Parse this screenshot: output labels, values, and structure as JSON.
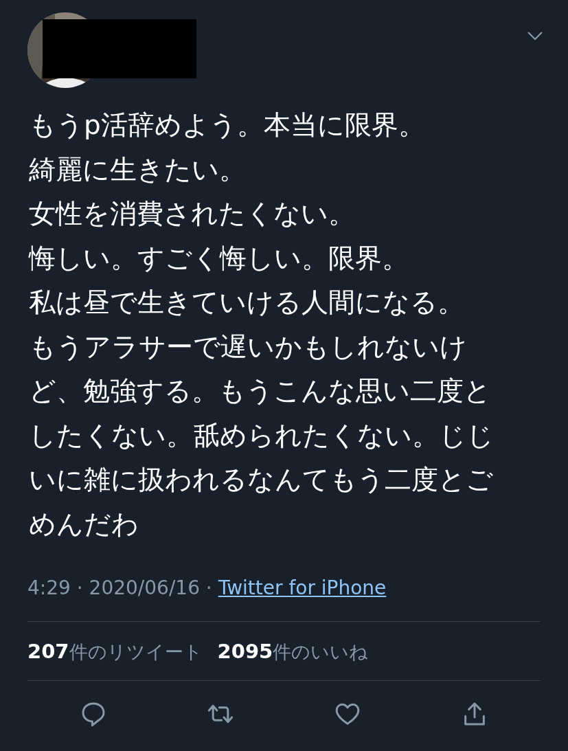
{
  "tweet": {
    "name_redacted": true,
    "text_lines": [
      "もうp活辞めよう。本当に限界。",
      "綺麗に生きたい。",
      "女性を消費されたくない。",
      "悔しい。すごく悔しい。限界。",
      "私は昼で生きていける人間になる。",
      "もうアラサーで遅いかもしれないけ",
      "ど、勉強する。もうこんな思い二度と",
      "したくない。舐められたくない。じじ",
      "いに雑に扱われるなんてもう二度とご",
      "めんだわ"
    ],
    "timestamp": "4:29 · 2020/06/16 · ",
    "source": "Twitter for iPhone",
    "stats": [
      "**207**件のリツイート",
      "**2095**件のいいね"
    ],
    "actions": [
      {
        "kind": "reply"
      },
      {
        "kind": "retweet"
      },
      {
        "kind": "like"
      },
      {
        "kind": "share"
      }
    ]
  }
}
